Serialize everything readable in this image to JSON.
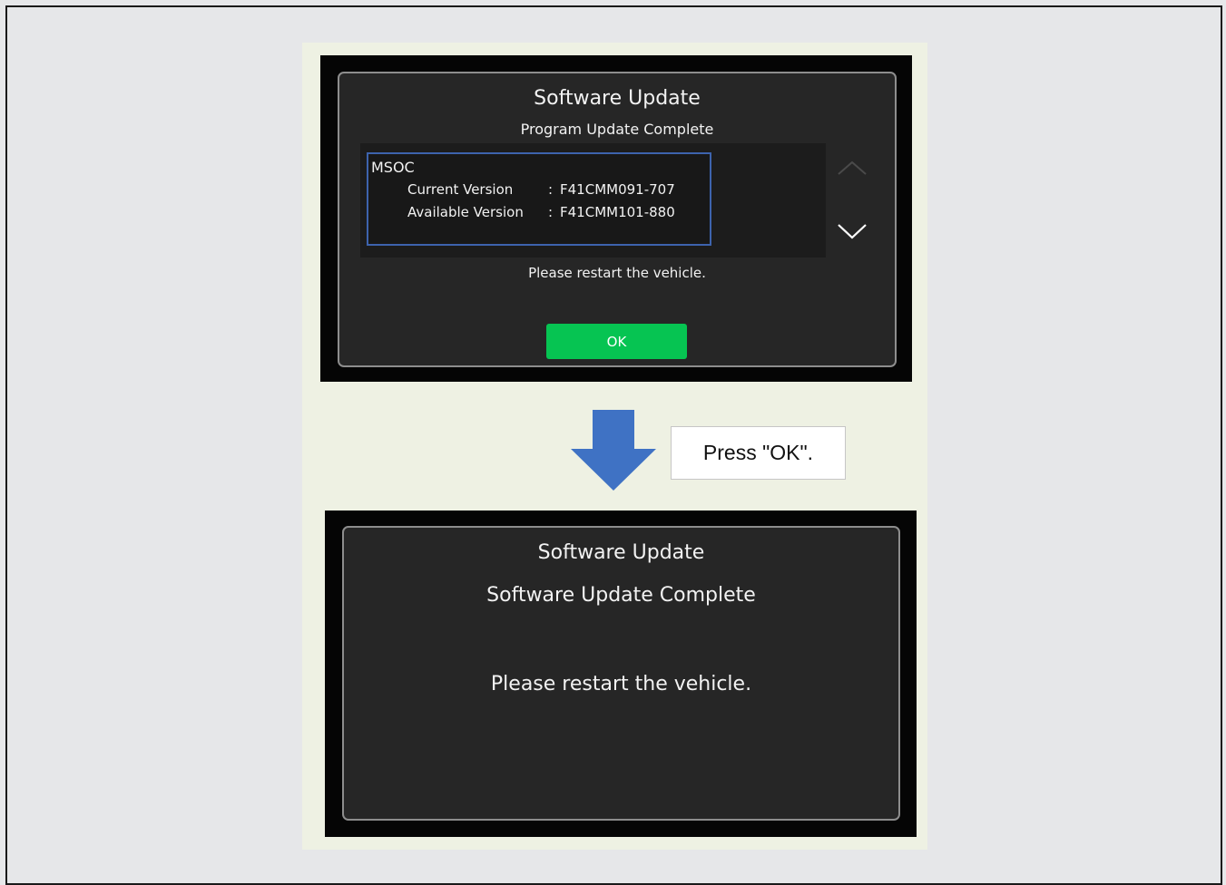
{
  "colors": {
    "page_bg": "#e7e8ea",
    "panel_bg": "#eef1e3",
    "screen_bg": "#050505",
    "dialog_bg": "#262626",
    "dialog_border": "#8d8d8d",
    "selection_border": "#3d63ad",
    "ok_button": "#06c452",
    "arrow": "#3f72c4"
  },
  "screen1": {
    "title": "Software Update",
    "subtitle": "Program Update Complete",
    "item": {
      "name": "MSOC",
      "current_label": "Current Version",
      "available_label": "Available Version",
      "separator": ":",
      "current_value": "F41CMM091-707",
      "available_value": "F41CMM101-880"
    },
    "scroll_up_icon": "chevron-up-icon",
    "scroll_down_icon": "chevron-down-icon",
    "message": "Please restart the vehicle.",
    "ok_label": "OK"
  },
  "callout": {
    "text": "Press \"OK\".",
    "arrow_icon": "arrow-down-icon"
  },
  "screen2": {
    "title": "Software Update",
    "subtitle": "Software Update Complete",
    "message": "Please restart the vehicle."
  }
}
